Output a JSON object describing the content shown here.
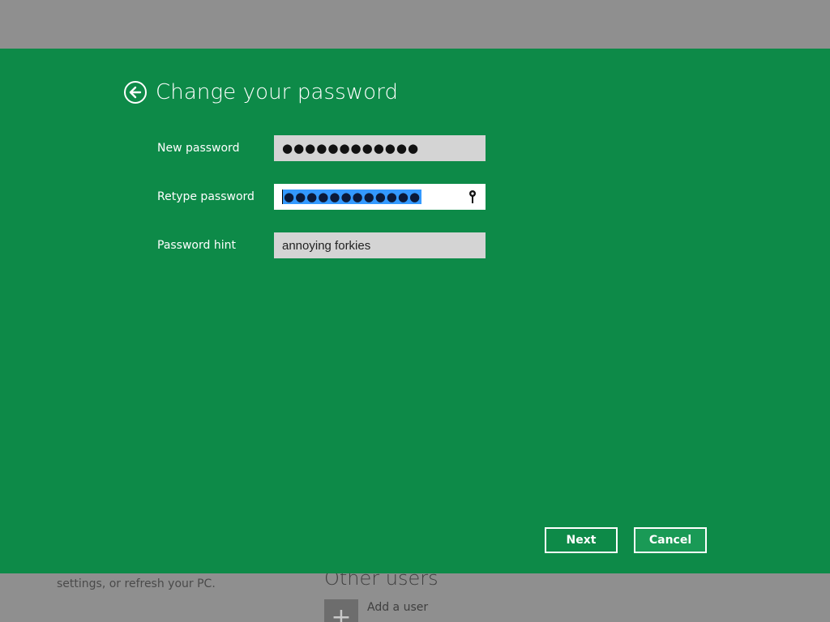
{
  "background": {
    "left_text": "settings, or refresh your PC.",
    "other_users_heading": "Other users",
    "add_user_label": "Add a user",
    "add_user_icon": "plus-icon"
  },
  "dialog": {
    "title": "Change your password",
    "back_icon": "back-arrow-icon",
    "fields": {
      "new_password": {
        "label": "New password",
        "value": "●●●●●●●●●●●●"
      },
      "retype_password": {
        "label": "Retype password",
        "value": "●●●●●●●●●●●●",
        "reveal_icon": "eye-reveal-icon"
      },
      "password_hint": {
        "label": "Password hint",
        "value": "annoying forkies"
      }
    },
    "buttons": {
      "next": "Next",
      "cancel": "Cancel"
    }
  },
  "colors": {
    "dialog_background": "#0d8a48",
    "page_background": "#8f8f8f",
    "selection": "#3399ff"
  }
}
